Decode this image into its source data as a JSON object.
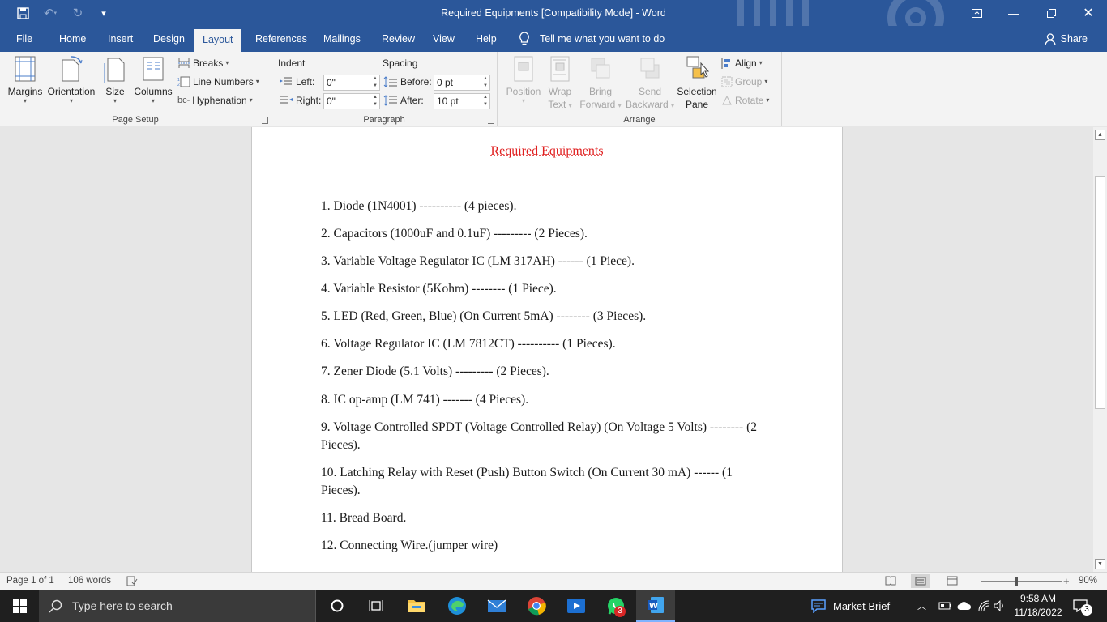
{
  "window": {
    "title": "Required Equipments [Compatibility Mode]  -  Word"
  },
  "tabs": [
    "File",
    "Home",
    "Insert",
    "Design",
    "Layout",
    "References",
    "Mailings",
    "Review",
    "View",
    "Help"
  ],
  "active_tab": "Layout",
  "tell_me": "Tell me what you want to do",
  "share": "Share",
  "ribbon": {
    "page_setup": {
      "label": "Page Setup",
      "margins": "Margins",
      "orientation": "Orientation",
      "size": "Size",
      "columns": "Columns",
      "breaks": "Breaks",
      "line_numbers": "Line Numbers",
      "hyphenation": "Hyphenation"
    },
    "paragraph": {
      "label": "Paragraph",
      "indent": "Indent",
      "spacing": "Spacing",
      "left_label": "Left:",
      "left_value": "0\"",
      "right_label": "Right:",
      "right_value": "0\"",
      "before_label": "Before:",
      "before_value": "0 pt",
      "after_label": "After:",
      "after_value": "10 pt"
    },
    "arrange": {
      "label": "Arrange",
      "position": "Position",
      "wrap_text_1": "Wrap",
      "wrap_text_2": "Text",
      "bring_forward_1": "Bring",
      "bring_forward_2": "Forward",
      "send_backward_1": "Send",
      "send_backward_2": "Backward",
      "selection_pane_1": "Selection",
      "selection_pane_2": "Pane",
      "align": "Align",
      "group": "Group",
      "rotate": "Rotate"
    }
  },
  "document": {
    "title": "Required Equipments",
    "items": [
      "1. Diode (1N4001) ---------- (4 pieces).",
      "2. Capacitors (1000uF and 0.1uF) --------- (2 Pieces).",
      "3. Variable Voltage Regulator IC (LM 317AH) ------ (1 Piece).",
      "4. Variable Resistor (5Kohm) -------- (1 Piece).",
      "5. LED (Red, Green, Blue) (On Current 5mA) -------- (3 Pieces).",
      "6. Voltage Regulator IC (LM 7812CT) ---------- (1 Pieces).",
      "7. Zener Diode (5.1 Volts) --------- (2 Pieces).",
      "8. IC op-amp (LM 741) ------- (4 Pieces).",
      "9. Voltage Controlled SPDT (Voltage Controlled Relay) (On Voltage 5 Volts) -------- (2 Pieces).",
      "10. Latching Relay with Reset (Push) Button Switch (On Current 30 mA) ------ (1 Pieces).",
      "11. Bread Board.",
      "12. Connecting Wire.(jumper wire)"
    ]
  },
  "status": {
    "page": "Page 1 of 1",
    "words": "106 words",
    "zoom": "90%"
  },
  "taskbar": {
    "search_placeholder": "Type here to search",
    "market_brief": "Market Brief",
    "time": "9:58 AM",
    "date": "11/18/2022",
    "whatsapp_badge": "3",
    "notification_badge": "3"
  },
  "colors": {
    "word_blue": "#2b579a",
    "title_red": "#e02020"
  }
}
